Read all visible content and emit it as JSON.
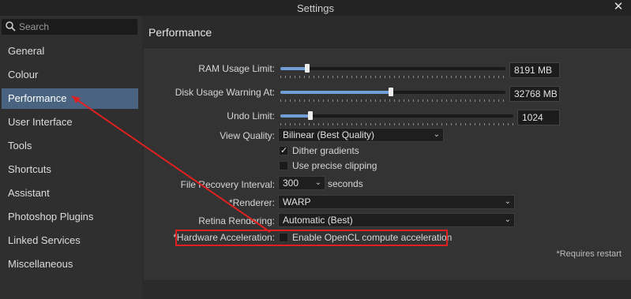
{
  "window": {
    "title": "Settings"
  },
  "search": {
    "placeholder": "Search"
  },
  "sidebar": {
    "items": [
      {
        "label": "General"
      },
      {
        "label": "Colour"
      },
      {
        "label": "Performance"
      },
      {
        "label": "User Interface"
      },
      {
        "label": "Tools"
      },
      {
        "label": "Shortcuts"
      },
      {
        "label": "Assistant"
      },
      {
        "label": "Photoshop Plugins"
      },
      {
        "label": "Linked Services"
      },
      {
        "label": "Miscellaneous"
      }
    ],
    "active": "Performance"
  },
  "main": {
    "title": "Performance",
    "ram": {
      "label": "RAM Usage Limit:",
      "value": "8191 MB",
      "level": 0.12
    },
    "disk": {
      "label": "Disk Usage Warning At:",
      "value": "32768 MB",
      "level": 0.49
    },
    "undo": {
      "label": "Undo Limit:",
      "value": "1024",
      "level": 0.13
    },
    "view_quality": {
      "label": "View Quality:",
      "value": "Bilinear (Best Quality)"
    },
    "dither": {
      "label": "Dither gradients",
      "checked": true
    },
    "precise_clipping": {
      "label": "Use precise clipping",
      "checked": false
    },
    "file_recovery": {
      "label": "File Recovery Interval:",
      "value": "300",
      "unit": "seconds"
    },
    "renderer": {
      "label": "*Renderer:",
      "value": "WARP"
    },
    "retina": {
      "label": "Retina Rendering:",
      "value": "Automatic (Best)"
    },
    "hw_accel": {
      "label": "*Hardware Acceleration:",
      "checkbox_label": "Enable OpenCL compute acceleration",
      "checked": false
    },
    "requires_restart": "*Requires restart"
  },
  "colors": {
    "accent": "#6f9fd6",
    "selected_nav": "#4a6380",
    "annotation": "#e02020"
  }
}
